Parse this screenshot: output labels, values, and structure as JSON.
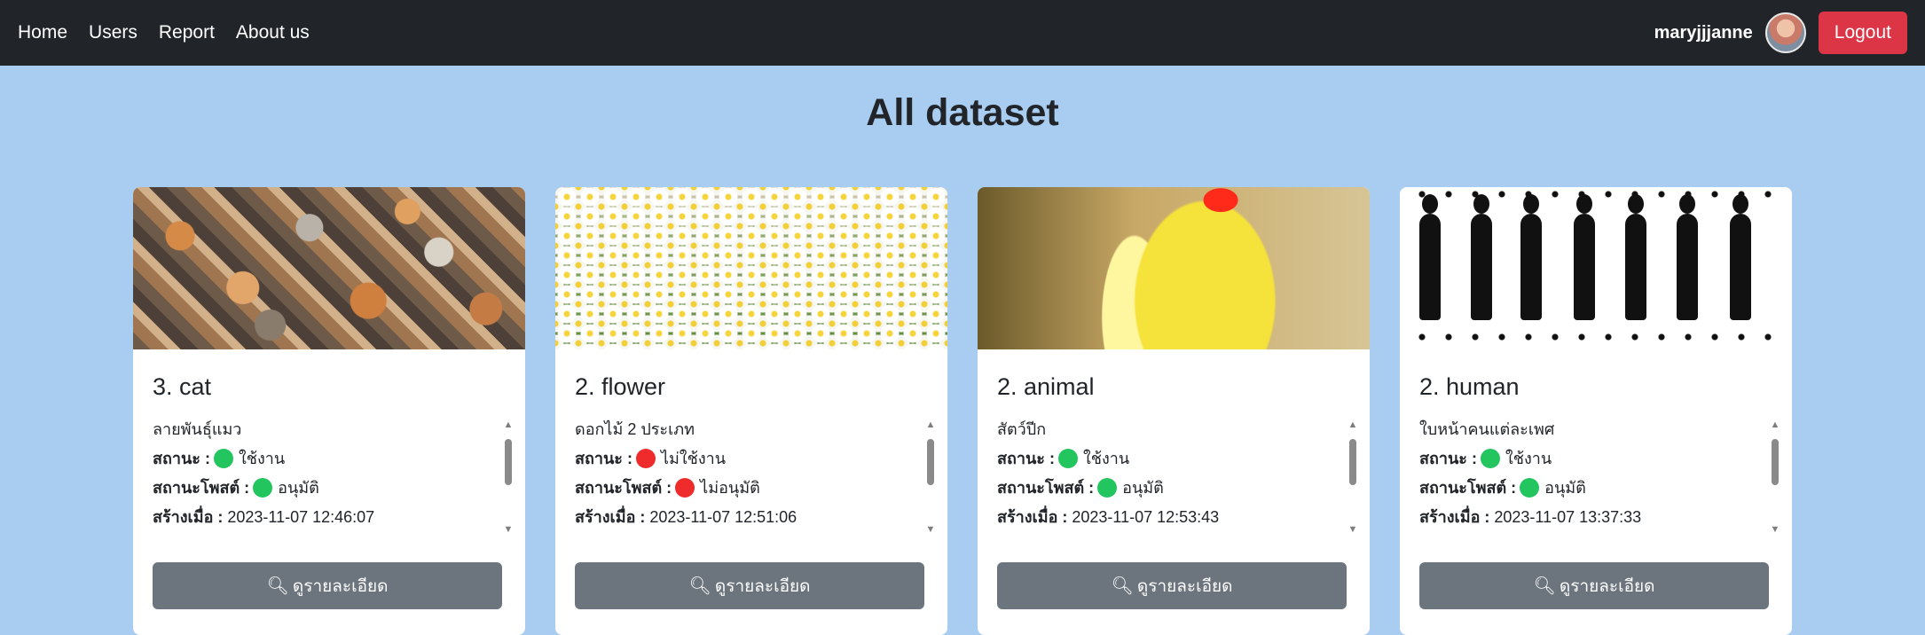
{
  "nav": {
    "links": [
      "Home",
      "Users",
      "Report",
      "About us"
    ],
    "username": "maryjjjanne",
    "logout_label": "Logout"
  },
  "page": {
    "title": "All dataset"
  },
  "cards": [
    {
      "title": "3. cat",
      "description": "ลายพันธุ์แมว",
      "status_label": "สถานะ :",
      "status_value": "ใช้งาน",
      "status_color": "#22c55e",
      "approval_label": "สถานะโพสต์ :",
      "approval_value": "อนุมัติ",
      "approval_color": "#22c55e",
      "created_label": "สร้างเมื่อ :",
      "created_value": "2023-11-07 12:46:07",
      "button_label": "ดูรายละเอียด",
      "image_icon": "cats-photo"
    },
    {
      "title": "2. flower",
      "description": "ดอกไม้ 2 ประเภท",
      "status_label": "สถานะ :",
      "status_value": "ไม่ใช้งาน",
      "status_color": "#ef2b2b",
      "approval_label": "สถานะโพสต์ :",
      "approval_value": "ไม่อนุมัติ",
      "approval_color": "#ef2b2b",
      "created_label": "สร้างเมื่อ :",
      "created_value": "2023-11-07 12:51:06",
      "button_label": "ดูรายละเอียด",
      "image_icon": "flowers-photo"
    },
    {
      "title": "2. animal",
      "description": "สัตว์ปีก",
      "status_label": "สถานะ :",
      "status_value": "ใช้งาน",
      "status_color": "#22c55e",
      "approval_label": "สถานะโพสต์ :",
      "approval_value": "อนุมัติ",
      "approval_color": "#22c55e",
      "created_label": "สร้างเมื่อ :",
      "created_value": "2023-11-07 12:53:43",
      "button_label": "ดูรายละเอียด",
      "image_icon": "parrot-photo"
    },
    {
      "title": "2. human",
      "description": "ใบหน้าคนแต่ละเพศ",
      "status_label": "สถานะ :",
      "status_value": "ใช้งาน",
      "status_color": "#22c55e",
      "approval_label": "สถานะโพสต์ :",
      "approval_value": "อนุมัติ",
      "approval_color": "#22c55e",
      "created_label": "สร้างเมื่อ :",
      "created_value": "2023-11-07 13:37:33",
      "button_label": "ดูรายละเอียด",
      "image_icon": "silhouettes-photo"
    }
  ]
}
